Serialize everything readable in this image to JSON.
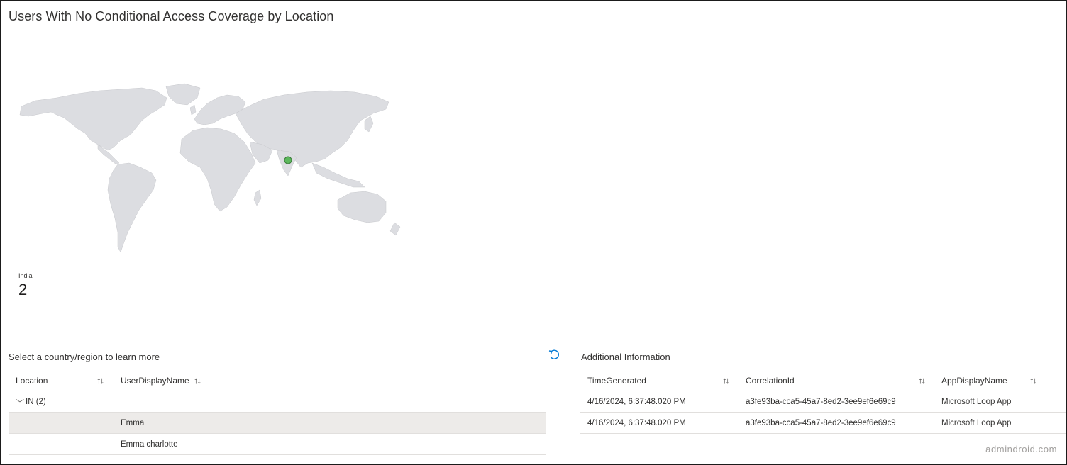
{
  "title": "Users With No Conditional Access Coverage by Location",
  "map": {
    "marker_color": "#5cb85c",
    "land_color": "#dcdde1",
    "marker_location": "India",
    "marker_lat": 21,
    "marker_lon": 78
  },
  "tile": {
    "label": "India",
    "value": "2"
  },
  "left_panel": {
    "title": "Select a country/region to learn more",
    "reset_icon": "undo-icon",
    "columns": [
      "Location",
      "UserDisplayName"
    ],
    "sort_glyph": "↑↓",
    "group": {
      "expand_icon": "chevron-down-icon",
      "label": "IN (2)"
    },
    "rows": [
      {
        "location": "",
        "user": "Emma"
      },
      {
        "location": "",
        "user": "Emma charlotte"
      }
    ]
  },
  "right_panel": {
    "title": "Additional Information",
    "columns": [
      "TimeGenerated",
      "CorrelationId",
      "AppDisplayName"
    ],
    "sort_glyph": "↑↓",
    "rows": [
      {
        "time": "4/16/2024, 6:37:48.020 PM",
        "correlation": "a3fe93ba-cca5-45a7-8ed2-3ee9ef6e69c9",
        "app": "Microsoft Loop App"
      },
      {
        "time": "4/16/2024, 6:37:48.020 PM",
        "correlation": "a3fe93ba-cca5-45a7-8ed2-3ee9ef6e69c9",
        "app": "Microsoft Loop App"
      }
    ]
  },
  "watermark": "admindroid.com"
}
